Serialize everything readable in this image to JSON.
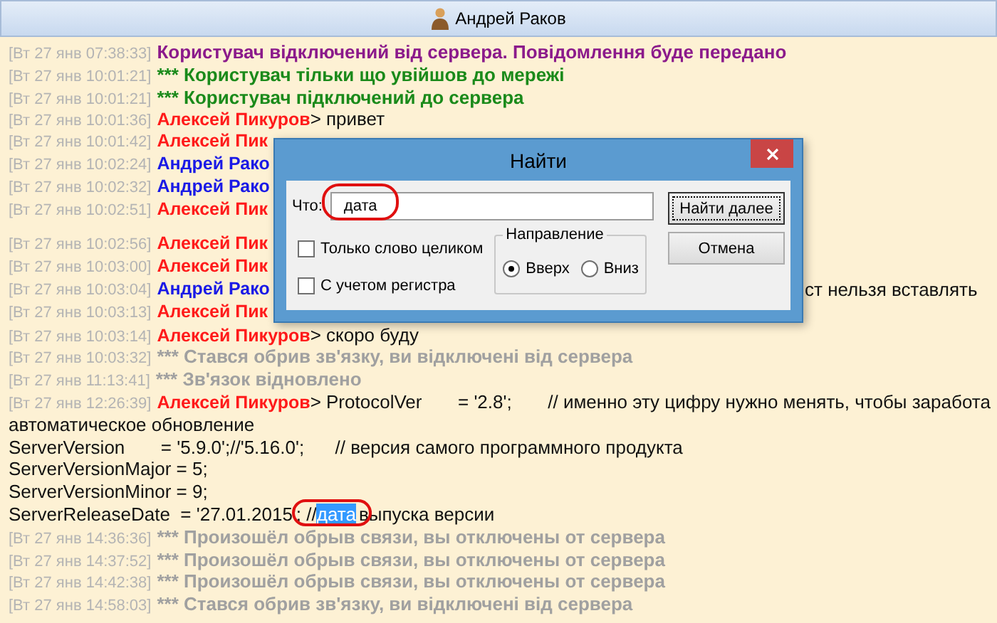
{
  "header": {
    "user": "Андрей Раков"
  },
  "log_blocks": [
    {
      "rows": [
        {
          "kind": "system",
          "time": "[Вт 27 янв 07:38:33]",
          "color": "#8b1a8b",
          "text": "Користувач відключений від сервера. Повідомлення буде передано"
        },
        {
          "kind": "system",
          "time": "[Вт 27 янв 10:01:21]",
          "color": "#1a8a1a",
          "text": "*** Користувач тільки що увійшов до мережі"
        },
        {
          "kind": "system",
          "time": "[Вт 27 янв 10:01:21]",
          "color": "#1a8a1a",
          "text": "*** Користувач підключений до сервера"
        },
        {
          "kind": "message",
          "time": "[Вт 27 янв 10:01:36]",
          "sender": "Алексей Пикуров",
          "color": "#ff1a1a",
          "text": "> привет"
        },
        {
          "kind": "message",
          "time": "[Вт 27 янв 10:01:42]",
          "sender": "Алексей Пик",
          "color": "#ff1a1a"
        },
        {
          "kind": "message",
          "time": "[Вт 27 янв 10:02:24]",
          "sender": "Андрей Рако",
          "color": "#1a1ae6"
        },
        {
          "kind": "message",
          "time": "[Вт 27 янв 10:02:32]",
          "sender": "Андрей Рако",
          "color": "#1a1ae6"
        },
        {
          "kind": "message",
          "time": "[Вт 27 янв 10:02:51]",
          "sender": "Алексей Пик",
          "color": "#ff1a1a"
        }
      ]
    },
    {
      "rows": [
        {
          "kind": "message",
          "time": "[Вт 27 янв 10:02:56]",
          "sender": "Алексей Пик",
          "color": "#ff1a1a"
        },
        {
          "kind": "message",
          "time": "[Вт 27 янв 10:03:00]",
          "sender": "Алексей Пик",
          "color": "#ff1a1a"
        },
        {
          "kind": "message",
          "time": "[Вт 27 янв 10:03:04]",
          "sender": "Андрей Рако",
          "color": "#1a1ae6",
          "text_right": "ст нельзя вставлять"
        },
        {
          "kind": "message",
          "time": "[Вт 27 янв 10:03:13]",
          "sender": "Алексей Пик",
          "color": "#ff1a1a"
        },
        {
          "kind": "message",
          "time": "[Вт 27 янв 10:03:14]",
          "sender": "Алексей Пикуров",
          "color": "#ff1a1a",
          "text": "> скоро буду"
        },
        {
          "kind": "system",
          "time": "[Вт 27 янв 10:03:32]",
          "color": "#a0a0a0",
          "text": "*** Стався обрив зв'язку, ви відключені від сервера"
        },
        {
          "kind": "system",
          "time": "[Вт 27 янв 11:13:41]",
          "color": "#a0a0a0",
          "text": "*** Зв'язок відновлено"
        },
        {
          "kind": "message",
          "time": "[Вт 27 янв 12:26:39]",
          "sender": "Алексей Пикуров",
          "color": "#ff1a1a",
          "text": "> ProtocolVer       = '2.8';       // именно эту цифру нужно менять, чтобы заработа"
        },
        {
          "kind": "code",
          "spans": [
            {
              "text": "автоматическое обновление",
              "selected": false
            }
          ]
        },
        {
          "kind": "code",
          "spans": [
            {
              "text": "ServerVersion       = '5.9.0';//'5.16.0';      // версия самого программного продукта",
              "selected": false
            }
          ]
        },
        {
          "kind": "code",
          "spans": [
            {
              "text": "ServerVersionMajor = 5;",
              "selected": false
            }
          ]
        },
        {
          "kind": "code",
          "spans": [
            {
              "text": "ServerVersionMinor = 9;",
              "selected": false
            }
          ]
        },
        {
          "kind": "code",
          "spans": [
            {
              "text": "ServerReleaseDate  = '27.01.2015'; //",
              "selected": false
            },
            {
              "text": "дата",
              "selected": true
            },
            {
              "text": "выпуска версии",
              "selected": false
            }
          ]
        },
        {
          "kind": "system",
          "time": "[Вт 27 янв 14:36:36]",
          "color": "#a0a0a0",
          "text": "*** Произошёл обрыв связи, вы отключены от сервера"
        },
        {
          "kind": "system",
          "time": "[Вт 27 янв 14:37:52]",
          "color": "#a0a0a0",
          "text": "*** Произошёл обрыв связи, вы отключены от сервера"
        },
        {
          "kind": "system",
          "time": "[Вт 27 янв 14:42:38]",
          "color": "#a0a0a0",
          "text": "*** Произошёл обрыв связи, вы отключены от сервера"
        },
        {
          "kind": "system",
          "time": "[Вт 27 янв 14:58:03]",
          "color": "#a0a0a0",
          "text": "*** Стався обрив зв'язку, ви відключені від сервера"
        }
      ]
    }
  ],
  "find_dialog": {
    "title": "Найти",
    "what_label": "Что:",
    "what_value": "дата",
    "find_next": "Найти далее",
    "cancel": "Отмена",
    "options": [
      {
        "label": "Только слово целиком",
        "checked": false
      },
      {
        "label": "С учетом регистра",
        "checked": false
      }
    ],
    "direction": {
      "label": "Направление",
      "options": [
        {
          "label": "Вверх",
          "selected": true
        },
        {
          "label": "Вниз",
          "selected": false
        }
      ]
    }
  }
}
